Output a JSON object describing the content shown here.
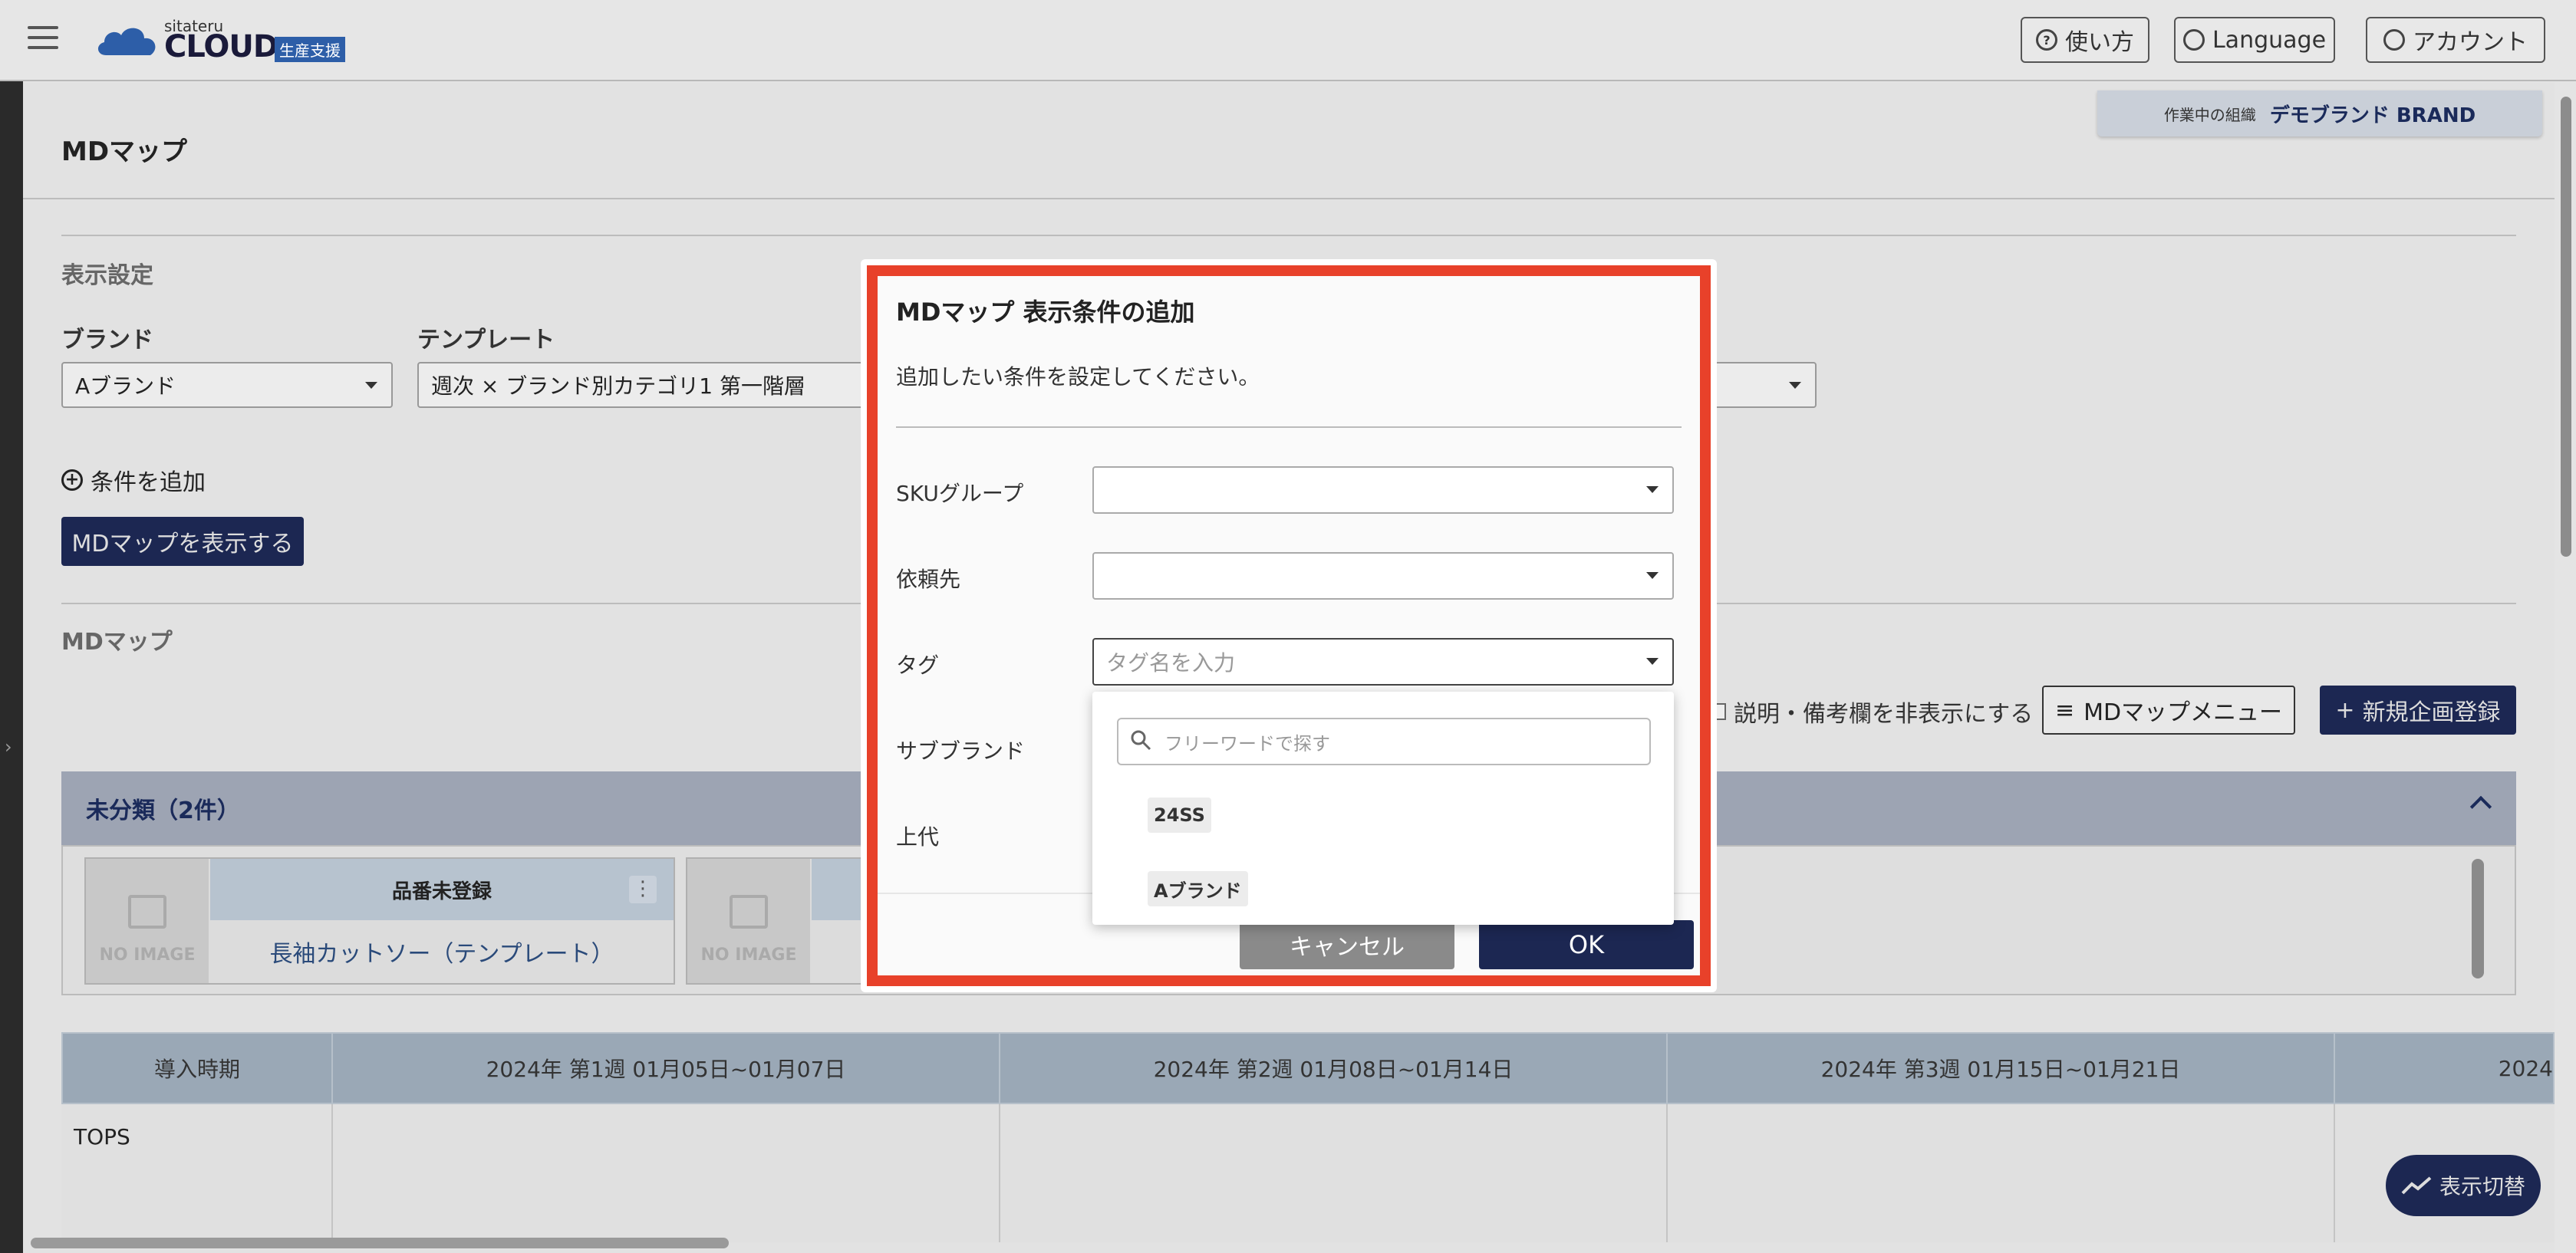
{
  "header": {
    "logo_small": "sitateru",
    "logo_main": "CLOUD",
    "logo_badge": "生産支援",
    "help_label": "使い方",
    "language_label": "Language",
    "account_label": "アカウント"
  },
  "org": {
    "label": "作業中の組織",
    "value": "デモブランド BRAND"
  },
  "page": {
    "title": "MDマップ",
    "display_settings": "表示設定",
    "brand_label": "ブランド",
    "brand_value": "Aブランド",
    "template_label": "テンプレート",
    "template_value": "週次 × ブランド別カテゴリ1 第一階層",
    "add_condition": "条件を追加",
    "show_button": "MDマップを表示する",
    "mdmap_section": "MDマップ",
    "hide_notes": "説明・備考欄を非表示にする",
    "menu_button": "MDマップメニュー",
    "new_button": "新規企画登録",
    "unclassified": "未分類（2件）",
    "cards": [
      {
        "no_image": "NO IMAGE",
        "top": "品番未登録",
        "name": "長袖カットソー（テンプレート）"
      },
      {
        "no_image": "NO IMAGE"
      }
    ],
    "grid_headers": [
      "導入時期",
      "2024年 第1週 01月05日~01月07日",
      "2024年 第2週 01月08日~01月14日",
      "2024年 第3週 01月15日~01月21日",
      "2024"
    ],
    "row_label": "TOPS",
    "switch_button": "表示切替"
  },
  "dialog": {
    "title": "MDマップ 表示条件の追加",
    "subtitle": "追加したい条件を設定してください。",
    "fields": {
      "sku_label": "SKUグループ",
      "vendor_label": "依頼先",
      "tag_label": "タグ",
      "tag_placeholder": "タグ名を入力",
      "subbrand_label": "サブブランド",
      "price_label": "上代"
    },
    "popup": {
      "search_placeholder": "フリーワードで探す",
      "options": [
        "24SS",
        "Aブランド"
      ]
    },
    "cancel_label": "キャンセル",
    "ok_label": "OK"
  },
  "colors": {
    "accent": "#1c2752",
    "highlight": "#e8412a"
  }
}
